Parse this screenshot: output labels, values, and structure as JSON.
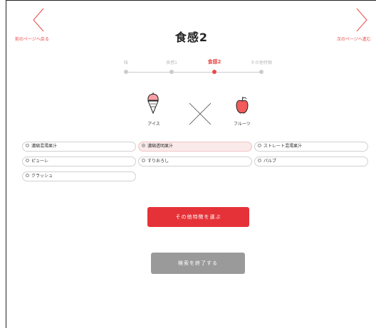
{
  "nav": {
    "back_label": "前のページへ戻る",
    "next_label": "次のページへ進む",
    "accent": "#e84a4a"
  },
  "page": {
    "title": "食感2"
  },
  "steps": [
    {
      "label": "味",
      "active": false
    },
    {
      "label": "食感1",
      "active": false
    },
    {
      "label": "食感2",
      "active": true
    },
    {
      "label": "その他特徴",
      "active": false
    }
  ],
  "combination": {
    "left": {
      "icon": "ice-cream-icon",
      "label": "アイス"
    },
    "separator_icon": "cross-icon",
    "right": {
      "icon": "apple-icon",
      "label": "フルーツ"
    }
  },
  "options": [
    {
      "label": "濃縮混濁果汁",
      "selected": false
    },
    {
      "label": "濃縮透明果汁",
      "selected": true
    },
    {
      "label": "ストレート混濁果汁",
      "selected": false
    },
    {
      "label": "ピューレ",
      "selected": false
    },
    {
      "label": "すりおろし",
      "selected": false
    },
    {
      "label": "パルプ",
      "selected": false
    },
    {
      "label": "クラッシュ",
      "selected": false
    }
  ],
  "buttons": {
    "other_features": "その他特徴を選ぶ",
    "finish_search": "検索を終了する"
  },
  "colors": {
    "primary": "#e53238",
    "disabled": "#9a9a9a",
    "selected_bg": "#fbeaea"
  }
}
